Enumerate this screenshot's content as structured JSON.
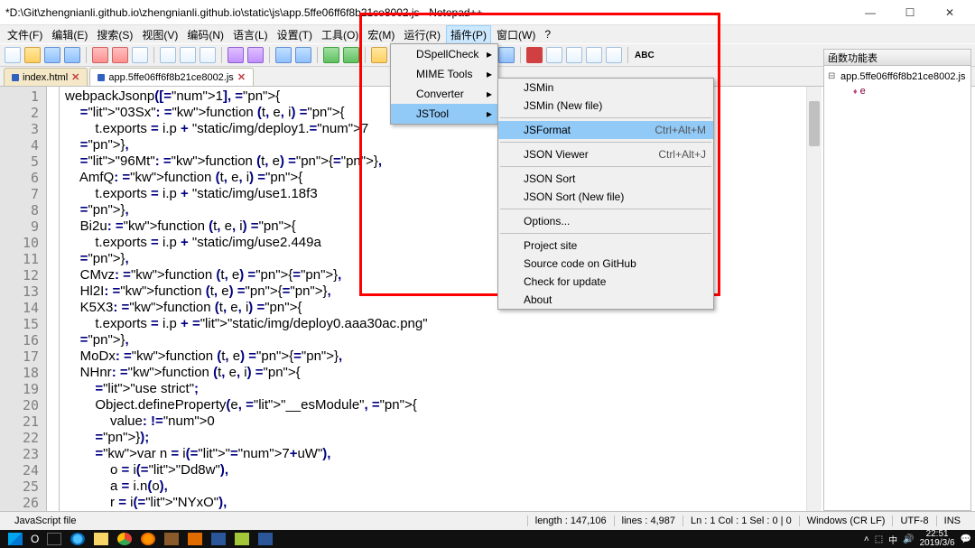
{
  "window": {
    "title": "*D:\\Git\\zhengnianli.github.io\\zhengnianli.github.io\\static\\js\\app.5ffe06ff6f8b21ce8002.js - Notepad++",
    "min": "—",
    "max": "☐",
    "close": "✕"
  },
  "menubar": [
    "文件(F)",
    "编辑(E)",
    "搜索(S)",
    "视图(V)",
    "编码(N)",
    "语言(L)",
    "设置(T)",
    "工具(O)",
    "宏(M)",
    "运行(R)",
    "插件(P)",
    "窗口(W)",
    "?"
  ],
  "menubar_open_index": 10,
  "tabs": [
    {
      "label": "index.html",
      "active": false
    },
    {
      "label": "app.5ffe06ff6f8b21ce8002.js",
      "active": true
    }
  ],
  "panel": {
    "title": "函数功能表",
    "root": "app.5ffe06ff6f8b21ce8002.js",
    "leaf": "e"
  },
  "plugin_menu": {
    "level1": [
      {
        "label": "DSpellCheck",
        "sub": true
      },
      {
        "label": "MIME Tools",
        "sub": true
      },
      {
        "label": "Converter",
        "sub": true
      },
      {
        "label": "JSTool",
        "sub": true,
        "hover": true
      }
    ],
    "level2": [
      {
        "label": "JSMin"
      },
      {
        "label": "JSMin (New file)"
      },
      {
        "sep": true
      },
      {
        "label": "JSFormat",
        "shortcut": "Ctrl+Alt+M",
        "hover": true
      },
      {
        "sep": true
      },
      {
        "label": "JSON Viewer",
        "shortcut": "Ctrl+Alt+J"
      },
      {
        "sep": true
      },
      {
        "label": "JSON Sort"
      },
      {
        "label": "JSON Sort (New file)"
      },
      {
        "sep": true
      },
      {
        "label": "Options..."
      },
      {
        "sep": true
      },
      {
        "label": "Project site"
      },
      {
        "label": "Source code on GitHub"
      },
      {
        "label": "Check for update"
      },
      {
        "label": "About"
      }
    ]
  },
  "code_lines": [
    "webpackJsonp([1], {",
    "    \"03Sx\": function (t, e, i) {",
    "        t.exports = i.p + \"static/img/deploy1.7",
    "    },",
    "    \"96Mt\": function (t, e) {},",
    "    AmfQ: function (t, e, i) {",
    "        t.exports = i.p + \"static/img/use1.18f3",
    "    },",
    "    Bi2u: function (t, e, i) {",
    "        t.exports = i.p + \"static/img/use2.449a",
    "    },",
    "    CMvz: function (t, e) {},",
    "    Hl2I: function (t, e) {},",
    "    K5X3: function (t, e, i) {",
    "        t.exports = i.p + \"static/img/deploy0.aaa30ac.png\"",
    "    },",
    "    MoDx: function (t, e) {},",
    "    NHnr: function (t, e, i) {",
    "        \"use strict\";",
    "        Object.defineProperty(e, \"__esModule\", {",
    "            value: !0",
    "        });",
    "        var n = i(\"7+uW\"),",
    "            o = i(\"Dd8w\"),",
    "            a = i.n(o),",
    "            r = i(\"NYxO\"),",
    "        "
  ],
  "status": {
    "type": "JavaScript file",
    "length": "length : 147,106",
    "lines": "lines : 4,987",
    "pos": "Ln : 1    Col : 1    Sel : 0 | 0",
    "eol": "Windows (CR LF)",
    "enc": "UTF-8",
    "ins": "INS"
  },
  "taskbar": {
    "time": "22:51",
    "date": "2019/3/6"
  }
}
